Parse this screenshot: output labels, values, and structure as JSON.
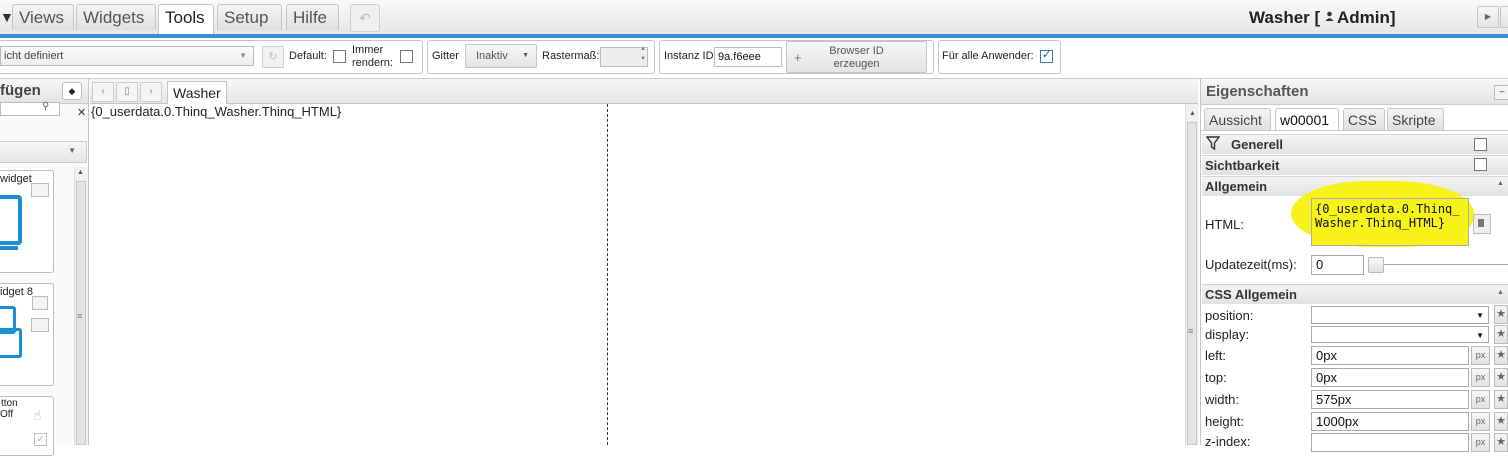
{
  "menu": {
    "partial_glyph": "▼",
    "tabs": [
      "Views",
      "Widgets",
      "Tools",
      "Setup",
      "Hilfe"
    ],
    "active_tab": "Tools",
    "undo_glyph": "↶",
    "title": "Washer [",
    "title_user": "Admin]",
    "user_icon": "person-icon"
  },
  "toolbar": {
    "view_select": "icht definiert",
    "default_label": "Default:",
    "immer_label_1": "Immer",
    "immer_label_2": "rendern:",
    "gitter_label": "Gitter",
    "gitter_value": "Inaktiv",
    "rastermass_label": "Rastermaß:",
    "instanz_label": "Instanz ID",
    "instanz_value": "9a.f6eee",
    "browser_btn_1": "Browser ID",
    "browser_btn_2": "erzeugen",
    "fuer_alle_label": "Für alle Anwender:"
  },
  "left": {
    "header": "fügen",
    "card1_label": "widget",
    "card2_label": "idget 8",
    "card3_label_1": "tton",
    "card3_label_2": "Off"
  },
  "view": {
    "tab": "Washer",
    "content": "{0_userdata.0.Thinq_Washer.Thinq_HTML}"
  },
  "props": {
    "title": "Eigenschaften",
    "tabs": [
      "Aussicht",
      "w00001",
      "CSS",
      "Skripte"
    ],
    "active_tab": "w00001",
    "generell": "Generell",
    "sichtbarkeit": "Sichtbarkeit",
    "allgemein": "Allgemein",
    "html_label": "HTML:",
    "html_value": "{0_userdata.0.Thinq_Washer.Thinq_HTML}",
    "update_label": "Updatezeit(ms):",
    "update_value": "0",
    "css_allgemein": "CSS Allgemein",
    "position_label": "position:",
    "display_label": "display:",
    "left_label": "left:",
    "left_value": "0px",
    "top_label": "top:",
    "top_value": "0px",
    "width_label": "width:",
    "width_value": "575px",
    "height_label": "height:",
    "height_value": "1000px",
    "zindex_label": "z-index:",
    "px_unit": "px",
    "highlight_color": "#f7f21a"
  }
}
